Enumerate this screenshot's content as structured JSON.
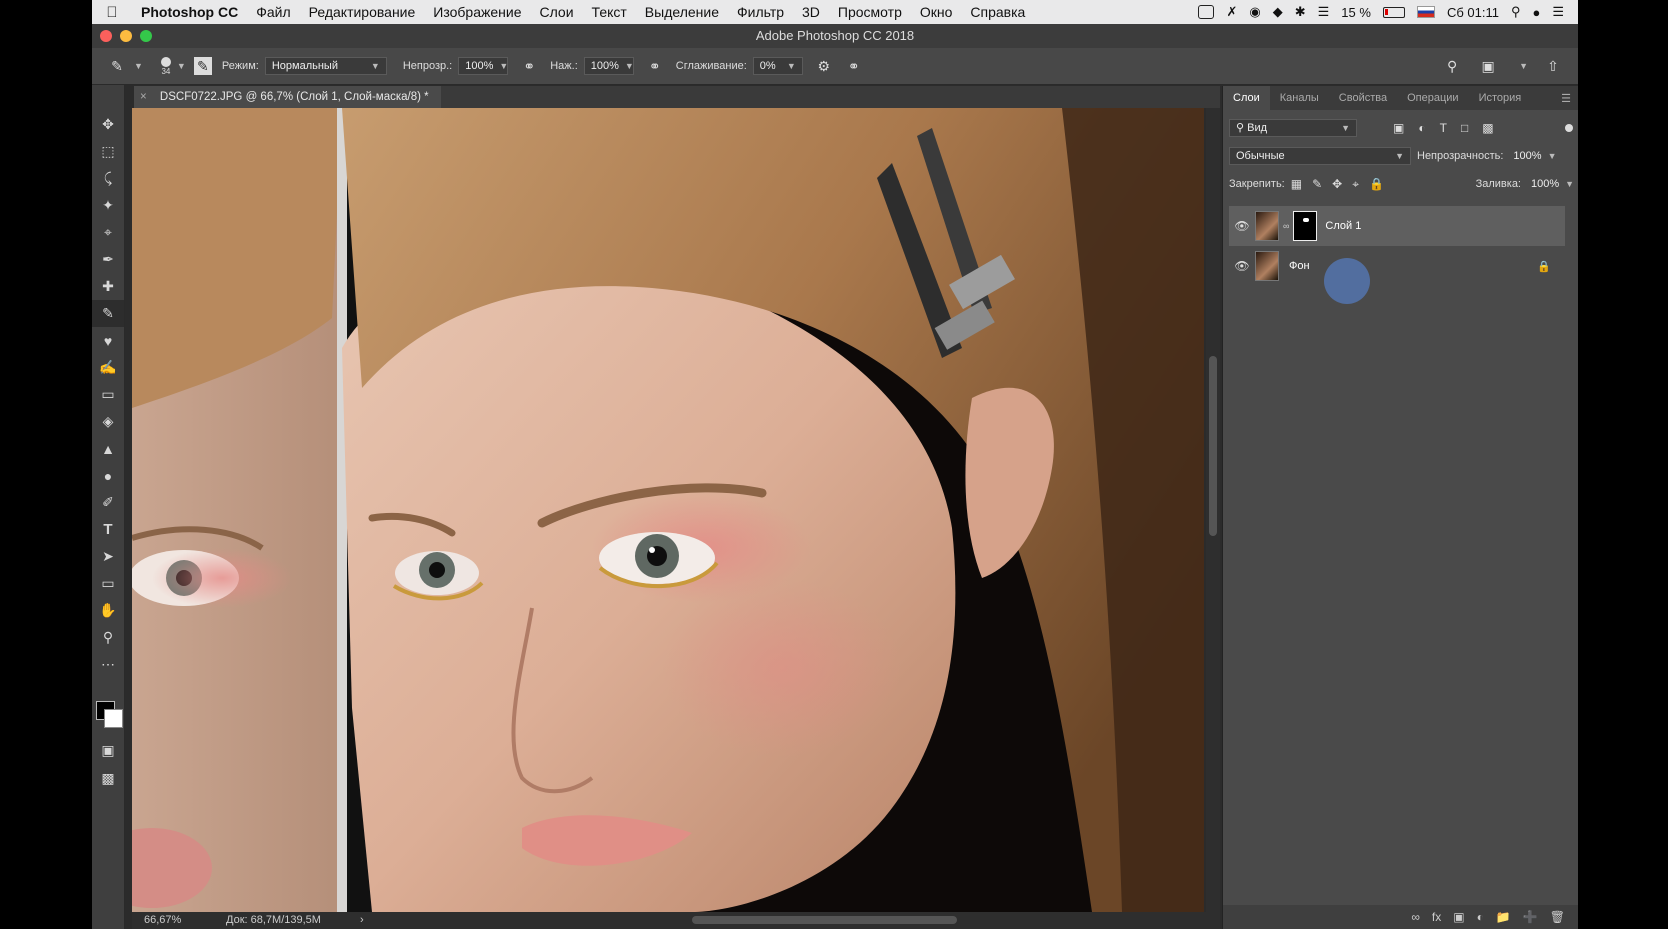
{
  "menubar": {
    "app": "Photoshop CC",
    "items": [
      "Файл",
      "Редактирование",
      "Изображение",
      "Слои",
      "Текст",
      "Выделение",
      "Фильтр",
      "3D",
      "Просмотр",
      "Окно",
      "Справка"
    ],
    "battery": "15 %",
    "clock": "Сб 01:11"
  },
  "window": {
    "title": "Adobe Photoshop CC 2018"
  },
  "options": {
    "brush_size": "34",
    "mode_label": "Режим:",
    "mode_value": "Нормальный",
    "opacity_label": "Непрозр.:",
    "opacity_value": "100%",
    "pressure_label": "Наж.:",
    "pressure_value": "100%",
    "smoothing_label": "Сглаживание:",
    "smoothing_value": "0%"
  },
  "document": {
    "tab": "DSCF0722.JPG @ 66,7% (Слой 1, Слой-маска/8) *"
  },
  "status": {
    "zoom": "66,67%",
    "doc": "Док: 68,7M/139,5M"
  },
  "panel": {
    "tabs": [
      "Слои",
      "Каналы",
      "Свойства",
      "Операции",
      "История"
    ],
    "filter_label": "Вид",
    "blend_mode": "Обычные",
    "opacity_label": "Непрозрачность:",
    "opacity_value": "100%",
    "lock_label": "Закрепить:",
    "fill_label": "Заливка:",
    "fill_value": "100%",
    "layers": [
      {
        "name": "Слой 1"
      },
      {
        "name": "Фон"
      }
    ]
  }
}
